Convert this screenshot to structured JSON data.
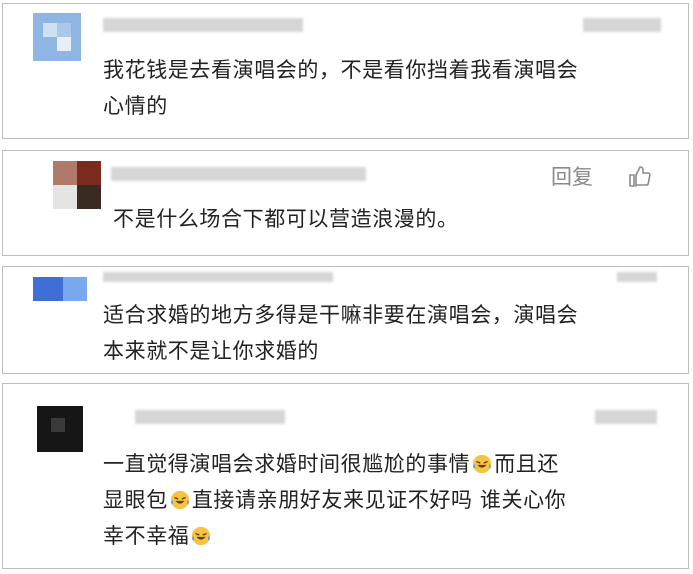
{
  "comments": [
    {
      "lines": [
        "我花钱是去看演唱会的，不是看你挡着我看演唱会",
        "心情的"
      ]
    },
    {
      "lines": [
        "不是什么场合下都可以营造浪漫的。"
      ],
      "reply_label": "回复"
    },
    {
      "lines": [
        "适合求婚的地方多得是干嘛非要在演唱会，演唱会",
        "本来就不是让你求婚的"
      ]
    },
    {
      "line1a": "一直觉得演唱会求婚时间很尴尬的事情",
      "line1b": "而且还",
      "line2a": "显眼包",
      "line2b": "直接请亲朋好友来见证不好吗 谁关心你",
      "line3a": "幸不幸福"
    }
  ],
  "icons": {
    "like": "thumbs-up-icon",
    "emoji": "laughing-crying-face-icon"
  },
  "colors": {
    "text": "#222222",
    "reply": "#8a8a8a",
    "border": "#bdbdbd"
  }
}
